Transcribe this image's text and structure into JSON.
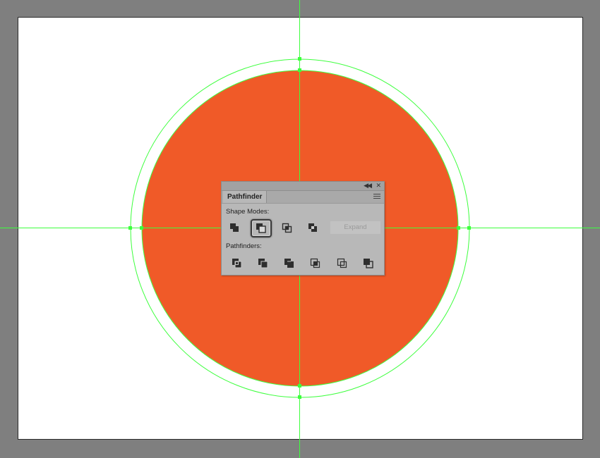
{
  "panel": {
    "tab_label": "Pathfinder",
    "shape_modes_label": "Shape Modes:",
    "pathfinders_label": "Pathfinders:",
    "expand_label": "Expand",
    "collapse_icon": "double-chevron-left",
    "close_icon": "close-x",
    "menu_icon": "panel-menu-lines",
    "shape_modes": [
      {
        "name": "unite",
        "icon": "unite-icon",
        "selected": false
      },
      {
        "name": "minus-front",
        "icon": "minus-front-icon",
        "selected": true
      },
      {
        "name": "intersect",
        "icon": "intersect-icon",
        "selected": false
      },
      {
        "name": "exclude",
        "icon": "exclude-icon",
        "selected": false
      }
    ],
    "pathfinders": [
      {
        "name": "divide",
        "icon": "divide-icon"
      },
      {
        "name": "trim",
        "icon": "trim-icon"
      },
      {
        "name": "merge",
        "icon": "merge-icon"
      },
      {
        "name": "crop",
        "icon": "crop-icon"
      },
      {
        "name": "outline",
        "icon": "outline-icon"
      },
      {
        "name": "minus-back",
        "icon": "minus-back-icon"
      }
    ]
  },
  "colors": {
    "pasteboard": "#7f7f7f",
    "artboard": "#ffffff",
    "circle_fill": "#f05a28",
    "guide": "#3dff3d",
    "panel_bg": "#b8b8b8"
  }
}
